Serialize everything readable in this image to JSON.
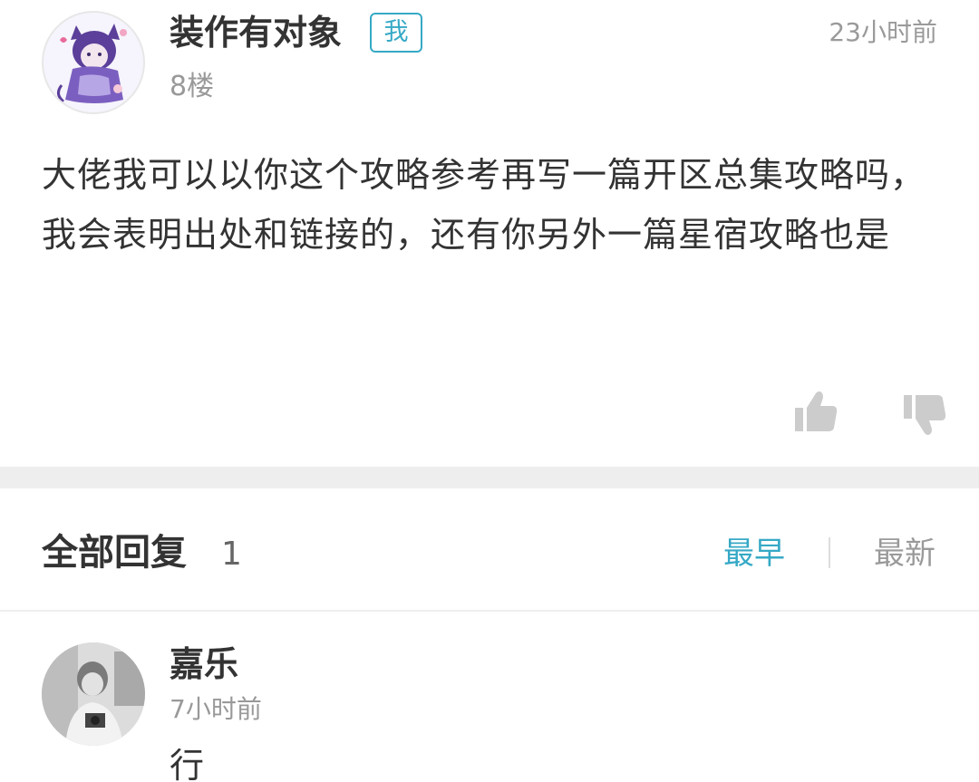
{
  "post": {
    "username": "装作有对象",
    "badge": "我",
    "time": "23小时前",
    "floor": "8楼",
    "content": "大佬我可以以你这个攻略参考再写一篇开区总集攻略吗，我会表明出处和链接的，还有你另外一篇星宿攻略也是",
    "icons": {
      "like": "thumbs-up-icon",
      "dislike": "thumbs-down-icon"
    }
  },
  "replies": {
    "title": "全部回复",
    "count": "1",
    "sort_earliest": "最早",
    "sort_newest": "最新",
    "active_sort": "最早",
    "items": [
      {
        "name": "嘉乐",
        "time": "7小时前",
        "text": "行"
      }
    ]
  },
  "colors": {
    "accent": "#36a9c6",
    "muted": "#9a9a9a",
    "text": "#333333",
    "divider": "#eeeeee"
  }
}
